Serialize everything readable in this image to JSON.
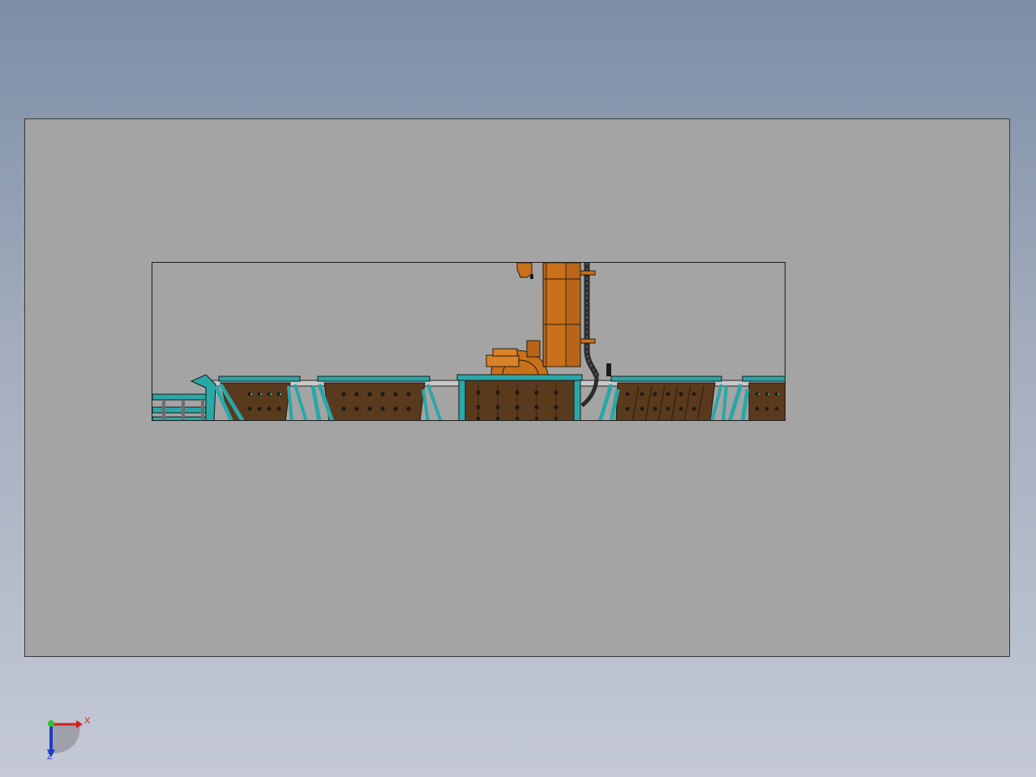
{
  "app": {
    "colors": {
      "background_top": "#7d8ea6",
      "background_bottom": "#c4c9d5",
      "sheet": "#a4a4a4",
      "robot_orange": "#c8701c",
      "frame_teal": "#2aa7a7",
      "panel_brown": "#5a3a1c",
      "rail_gray": "#c8c8c8",
      "cable_dark": "#2b2b2b"
    }
  },
  "drawing": {
    "view": "front",
    "components": [
      {
        "name": "robot-arm",
        "icon": "industrial-robot-icon"
      },
      {
        "name": "conveyor-frame",
        "icon": "conveyor-icon"
      },
      {
        "name": "fixture-panels",
        "icon": "fixture-panel-icon",
        "count": 5
      },
      {
        "name": "cable-carrier",
        "icon": "cable-icon"
      }
    ]
  },
  "triad": {
    "x_label": "X",
    "z_label": "Z",
    "icon": "coordinate-triad-icon"
  }
}
